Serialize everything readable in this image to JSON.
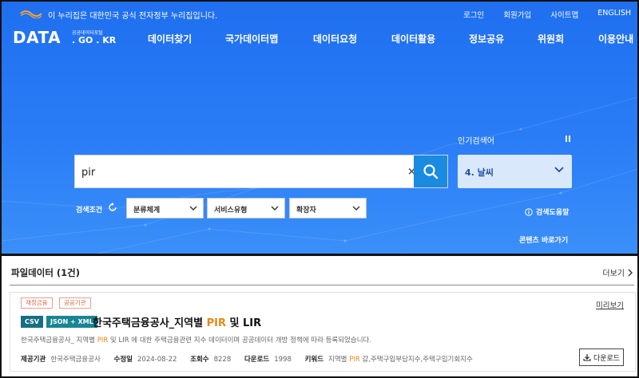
{
  "header": {
    "gov_notice": "이 누리집은 대한민국 공식 전자정부 누리집입니다.",
    "util_links": [
      "로그인",
      "회원가입",
      "사이트맵",
      "ENGLISH"
    ],
    "brand_big": "DATA",
    "brand_small_top": "공공데이터포털",
    "brand_small_bottom": ". GO . KR",
    "nav": [
      "데이터찾기",
      "국가데이터맵",
      "데이터요청",
      "데이터활용",
      "정보공유",
      "위원회",
      "이용안내"
    ]
  },
  "search": {
    "query": "pir",
    "clear_symbol": "×",
    "popular_label": "인기검색어",
    "popular_current": "4. 날씨",
    "condition_label": "검색조건",
    "filters": [
      "분류체계",
      "서비스유형",
      "확장자"
    ],
    "help_label": "검색도움말",
    "contents_label": "콘텐츠 바로가기"
  },
  "results": {
    "section_title": "파일데이터 (1건)",
    "more_label": "더보기",
    "item": {
      "badges": [
        "재정금융",
        "공공기관"
      ],
      "preview_label": "미리보기",
      "formats": [
        "CSV",
        "JSON + XML"
      ],
      "title_pre": "한국주택금융공사_지역별 ",
      "title_hl": "PIR",
      "title_post": " 및 LIR",
      "desc_pre": "한국주택금융공사_ 지역별 ",
      "desc_hl": "PIR",
      "desc_post": " 및 LIR 에 대한 주택금융관련 지수 데이터이며 공공데이터 개방 정책에 따라 등록되었습니다.",
      "provider_label": "제공기관",
      "provider": "한국주택금융공사",
      "modified_label": "수정일",
      "modified": "2024-08-22",
      "views_label": "조회수",
      "views": "8228",
      "downloads_label": "다운로드",
      "downloads": "1998",
      "keywords_label": "키워드",
      "keywords_pre": "지역별 ",
      "keywords_hl": "PIR",
      "keywords_post": " 값,주택구입부담지수,주택구입기회지수",
      "download_label": "다운로드"
    }
  },
  "colors": {
    "hero_blue": "#2a7df6",
    "search_button": "#1a8be0",
    "highlight": "#e78a14",
    "csv_badge": "#166e82",
    "json_badge": "#178593",
    "category_badge": "#d4674a"
  }
}
